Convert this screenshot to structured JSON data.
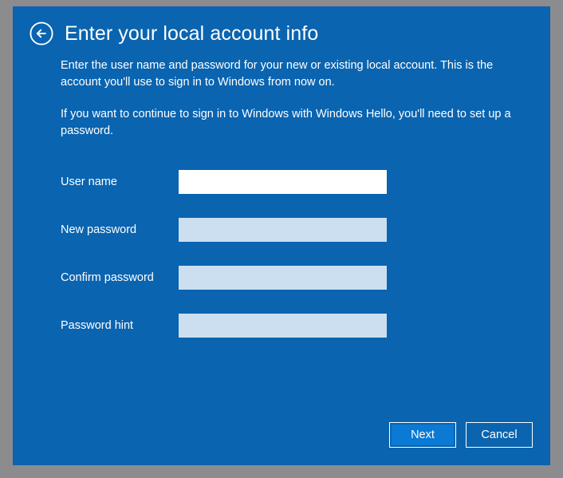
{
  "window": {
    "background_color": "#8c8c8e",
    "panel_color": "#0a64b0"
  },
  "header": {
    "back_icon": "back-arrow-circle-icon",
    "title": "Enter your local account info"
  },
  "body": {
    "paragraph_1": "Enter the user name and password for your new or existing local account. This is the account you'll use to sign in to Windows from now on.",
    "paragraph_2": "If you want to continue to sign in to Windows with Windows Hello, you'll need to set up a password."
  },
  "form": {
    "fields": [
      {
        "label": "User name",
        "value": "",
        "placeholder": "",
        "state": "focused"
      },
      {
        "label": "New password",
        "value": "",
        "placeholder": "",
        "state": "normal"
      },
      {
        "label": "Confirm password",
        "value": "",
        "placeholder": "",
        "state": "normal"
      },
      {
        "label": "Password hint",
        "value": "",
        "placeholder": "",
        "state": "normal"
      }
    ],
    "field_colors": {
      "focused": "#ffffff",
      "normal": "#cbdff0"
    }
  },
  "footer": {
    "next_label": "Next",
    "cancel_label": "Cancel",
    "primary_color": "#0a7ad4"
  }
}
